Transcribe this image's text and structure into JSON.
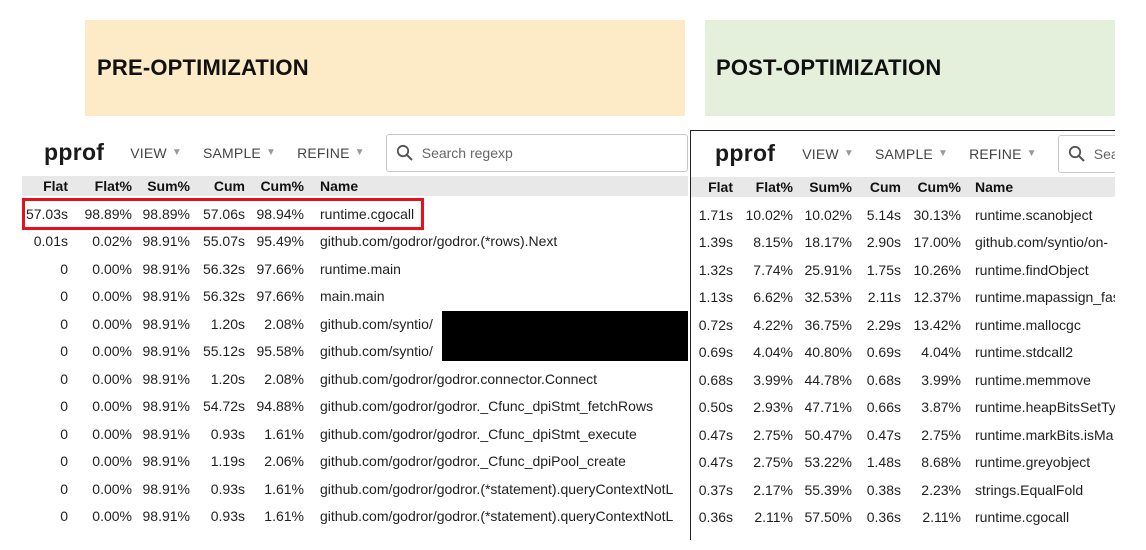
{
  "banners": {
    "pre": "PRE-OPTIMIZATION",
    "post": "POST-OPTIMIZATION"
  },
  "pre": {
    "logo": "pprof",
    "menus": [
      "VIEW",
      "SAMPLE",
      "REFINE"
    ],
    "search_placeholder": "Search regexp",
    "columns": [
      "Flat",
      "Flat%",
      "Sum%",
      "Cum",
      "Cum%",
      "Name"
    ],
    "rows": [
      [
        "57.03s",
        "98.89%",
        "98.89%",
        "57.06s",
        "98.94%",
        "runtime.cgocall"
      ],
      [
        "0.01s",
        "0.02%",
        "98.91%",
        "55.07s",
        "95.49%",
        "github.com/godror/godror.(*rows).Next"
      ],
      [
        "0",
        "0.00%",
        "98.91%",
        "56.32s",
        "97.66%",
        "runtime.main"
      ],
      [
        "0",
        "0.00%",
        "98.91%",
        "56.32s",
        "97.66%",
        "main.main"
      ],
      [
        "0",
        "0.00%",
        "98.91%",
        "1.20s",
        "2.08%",
        "github.com/syntio/"
      ],
      [
        "0",
        "0.00%",
        "98.91%",
        "55.12s",
        "95.58%",
        "github.com/syntio/"
      ],
      [
        "0",
        "0.00%",
        "98.91%",
        "1.20s",
        "2.08%",
        "github.com/godror/godror.connector.Connect"
      ],
      [
        "0",
        "0.00%",
        "98.91%",
        "54.72s",
        "94.88%",
        "github.com/godror/godror._Cfunc_dpiStmt_fetchRows"
      ],
      [
        "0",
        "0.00%",
        "98.91%",
        "0.93s",
        "1.61%",
        "github.com/godror/godror._Cfunc_dpiStmt_execute"
      ],
      [
        "0",
        "0.00%",
        "98.91%",
        "1.19s",
        "2.06%",
        "github.com/godror/godror._Cfunc_dpiPool_create"
      ],
      [
        "0",
        "0.00%",
        "98.91%",
        "0.93s",
        "1.61%",
        "github.com/godror/godror.(*statement).queryContextNotL"
      ],
      [
        "0",
        "0.00%",
        "98.91%",
        "0.93s",
        "1.61%",
        "github.com/godror/godror.(*statement).queryContextNotL"
      ]
    ]
  },
  "post": {
    "logo": "pprof",
    "menus": [
      "VIEW",
      "SAMPLE",
      "REFINE"
    ],
    "search_placeholder": "Sea",
    "columns": [
      "Flat",
      "Flat%",
      "Sum%",
      "Cum",
      "Cum%",
      "Name"
    ],
    "rows": [
      [
        "1.71s",
        "10.02%",
        "10.02%",
        "5.14s",
        "30.13%",
        "runtime.scanobject"
      ],
      [
        "1.39s",
        "8.15%",
        "18.17%",
        "2.90s",
        "17.00%",
        "github.com/syntio/on-"
      ],
      [
        "1.32s",
        "7.74%",
        "25.91%",
        "1.75s",
        "10.26%",
        "runtime.findObject"
      ],
      [
        "1.13s",
        "6.62%",
        "32.53%",
        "2.11s",
        "12.37%",
        "runtime.mapassign_fas"
      ],
      [
        "0.72s",
        "4.22%",
        "36.75%",
        "2.29s",
        "13.42%",
        "runtime.mallocgc"
      ],
      [
        "0.69s",
        "4.04%",
        "40.80%",
        "0.69s",
        "4.04%",
        "runtime.stdcall2"
      ],
      [
        "0.68s",
        "3.99%",
        "44.78%",
        "0.68s",
        "3.99%",
        "runtime.memmove"
      ],
      [
        "0.50s",
        "2.93%",
        "47.71%",
        "0.66s",
        "3.87%",
        "runtime.heapBitsSetTy"
      ],
      [
        "0.47s",
        "2.75%",
        "50.47%",
        "0.47s",
        "2.75%",
        "runtime.markBits.isMa"
      ],
      [
        "0.47s",
        "2.75%",
        "53.22%",
        "1.48s",
        "8.68%",
        "runtime.greyobject"
      ],
      [
        "0.37s",
        "2.17%",
        "55.39%",
        "0.38s",
        "2.23%",
        "strings.EqualFold"
      ],
      [
        "0.36s",
        "2.11%",
        "57.50%",
        "0.36s",
        "2.11%",
        "runtime.cgocall"
      ]
    ]
  },
  "colors": {
    "highlight": "#e8101f",
    "pre_banner": "#fcebc6",
    "post_banner": "#e5f0dc",
    "header_bg": "#e8e8e8"
  }
}
